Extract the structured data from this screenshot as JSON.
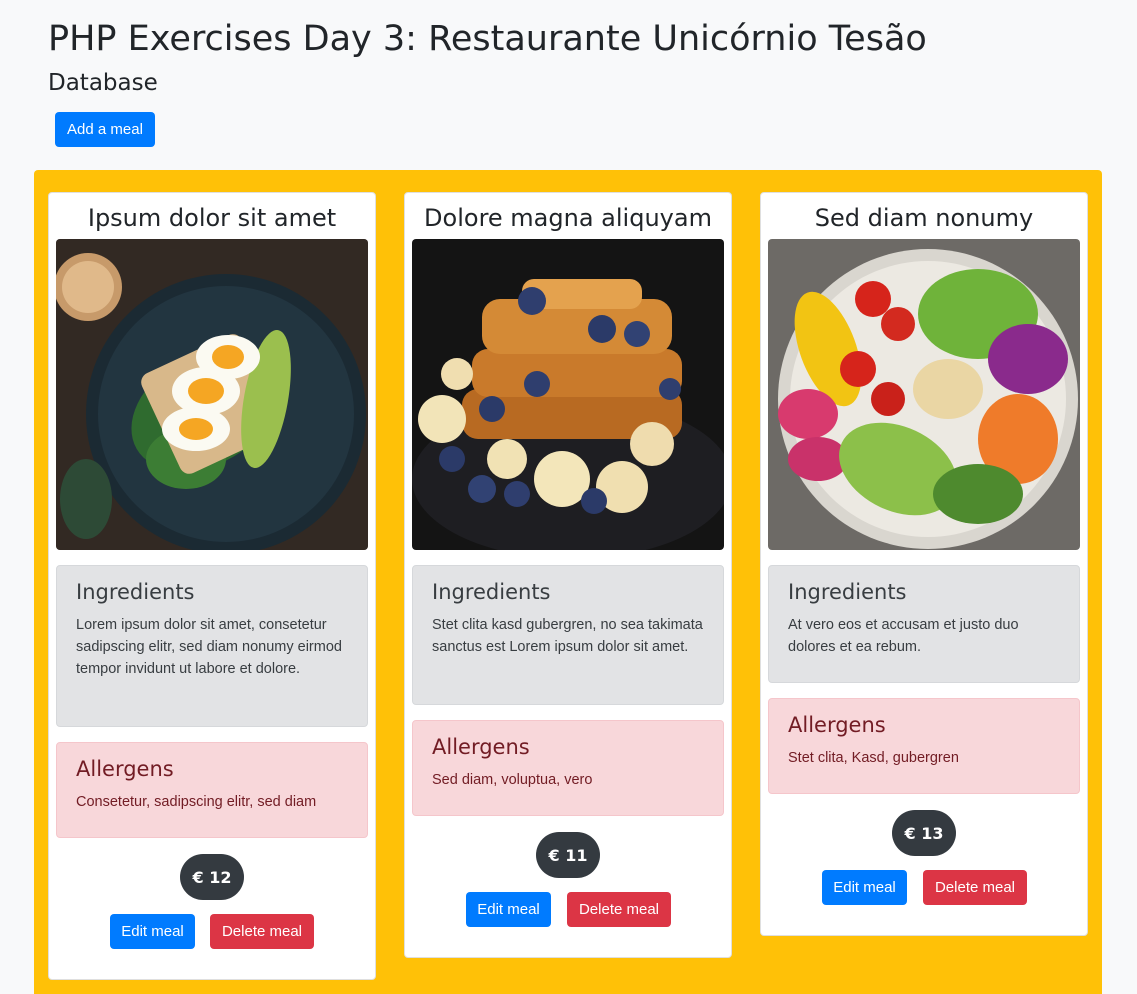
{
  "header": {
    "title": "PHP Exercises Day 3: Restaurante Unicórnio Tesão",
    "subtitle": "Database",
    "add_button": "Add a meal"
  },
  "meals": [
    {
      "name": "Ipsum dolor sit amet",
      "image": "egg-avocado-toast-photo",
      "ingredients_heading": "Ingredients",
      "ingredients": "Lorem ipsum dolor sit amet, consetetur sadipscing elitr, sed diam nonumy eirmod tempor invidunt ut labore et dolore.",
      "allergens_heading": "Allergens",
      "allergens": "Consetetur, sadipscing elitr, sed diam",
      "price": "€ 12",
      "edit_label": "Edit meal",
      "delete_label": "Delete meal"
    },
    {
      "name": "Dolore magna aliquyam",
      "image": "french-toast-blueberries-photo",
      "ingredients_heading": "Ingredients",
      "ingredients": "Stet clita kasd gubergren, no sea takimata sanctus est Lorem ipsum dolor sit amet.",
      "allergens_heading": "Allergens",
      "allergens": "Sed diam, voluptua, vero",
      "price": "€ 11",
      "edit_label": "Edit meal",
      "delete_label": "Delete meal"
    },
    {
      "name": "Sed diam nonumy",
      "image": "salad-bowl-photo",
      "ingredients_heading": "Ingredients",
      "ingredients": "At vero eos et accusam et justo duo dolores et ea rebum.",
      "allergens_heading": "Allergens",
      "allergens": "Stet clita, Kasd, gubergren",
      "price": "€ 13",
      "edit_label": "Edit meal",
      "delete_label": "Delete meal"
    }
  ],
  "colors": {
    "primary": "#007bff",
    "danger": "#dc3545",
    "band": "#ffc107",
    "price_badge": "#343a40"
  }
}
